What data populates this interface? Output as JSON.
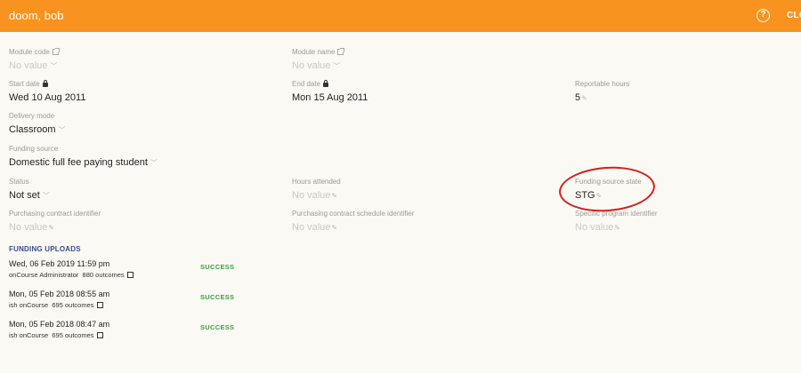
{
  "header": {
    "title": "doom, bob",
    "help_icon": "?",
    "close_label": "CLO"
  },
  "fields": {
    "module_code": {
      "label": "Module code",
      "value": "No value"
    },
    "module_name": {
      "label": "Module name",
      "value": "No value"
    },
    "start_date": {
      "label": "Start date",
      "value": "Wed 10 Aug 2011"
    },
    "end_date": {
      "label": "End date",
      "value": "Mon 15 Aug 2011"
    },
    "reportable_hours": {
      "label": "Reportable hours",
      "value": "5"
    },
    "delivery_mode": {
      "label": "Delivery mode",
      "value": "Classroom"
    },
    "funding_source": {
      "label": "Funding source",
      "value": "Domestic full fee paying student"
    },
    "status": {
      "label": "Status",
      "value": "Not set"
    },
    "hours_attended": {
      "label": "Hours attended",
      "value": "No value"
    },
    "funding_source_state": {
      "label": "Funding source state",
      "value": "STG"
    },
    "purchasing_contract_identifier": {
      "label": "Purchasing contract identifier",
      "value": "No value"
    },
    "purchasing_contract_schedule_identifier": {
      "label": "Purchasing contract schedule identifier",
      "value": "No value"
    },
    "specific_program_identifier": {
      "label": "Specific program identifier",
      "value": "No value"
    }
  },
  "funding_uploads": {
    "title": "FUNDING UPLOADS",
    "items": [
      {
        "when": "Wed, 06 Feb 2019 11:59 pm",
        "who": "onCourse Administrator",
        "outcomes": "880 outcomes",
        "status": "SUCCESS"
      },
      {
        "when": "Mon, 05 Feb 2018 08:55 am",
        "who": "ish onCourse",
        "outcomes": "695 outcomes",
        "status": "SUCCESS"
      },
      {
        "when": "Mon, 05 Feb 2018 08:47 am",
        "who": "ish onCourse",
        "outcomes": "695 outcomes",
        "status": "SUCCESS"
      }
    ]
  },
  "colors": {
    "header_bg": "#f7931e",
    "success": "#3aa04a",
    "section_title": "#3b4c8c",
    "annotation": "#d41f1f"
  },
  "icons": {
    "help": "help-circle-icon",
    "external_link": "external-link-icon",
    "lock": "lock-icon",
    "chevron": "chevron-down-icon",
    "pencil": "pencil-icon"
  }
}
